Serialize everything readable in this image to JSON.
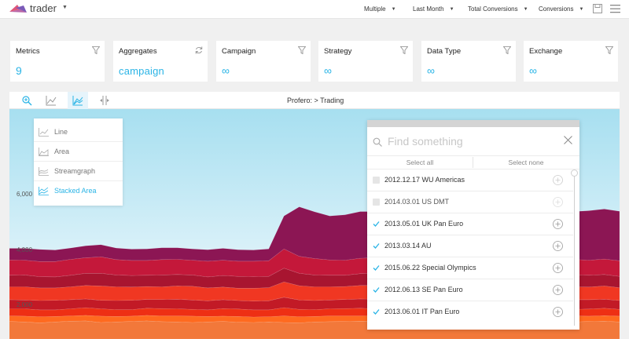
{
  "app": {
    "title": "trader"
  },
  "topbar": {
    "dropdowns": [
      {
        "label": "Multiple"
      },
      {
        "label": "Last Month"
      },
      {
        "label": "Total Conversions"
      },
      {
        "label": "Conversions"
      }
    ]
  },
  "cards": [
    {
      "title": "Metrics",
      "value": "9",
      "icon": "filter-icon"
    },
    {
      "title": "Aggregates",
      "value": "campaign",
      "icon": "refresh-icon"
    },
    {
      "title": "Campaign",
      "value": "∞",
      "icon": "filter-icon"
    },
    {
      "title": "Strategy",
      "value": "∞",
      "icon": "filter-icon"
    },
    {
      "title": "Data Type",
      "value": "∞",
      "icon": "filter-icon"
    },
    {
      "title": "Exchange",
      "value": "∞",
      "icon": "filter-icon"
    }
  ],
  "chart": {
    "breadcrumb": "Profero: > Trading",
    "chart_types": [
      {
        "label": "Line",
        "selected": false
      },
      {
        "label": "Area",
        "selected": false
      },
      {
        "label": "Streamgraph",
        "selected": false
      },
      {
        "label": "Stacked Area",
        "selected": true
      }
    ]
  },
  "finder": {
    "placeholder": "Find something",
    "select_all": "Select all",
    "select_none": "Select none",
    "items": [
      {
        "label": "2012.12.17 WU Americas",
        "checked": false
      },
      {
        "label": "2014.03.01 US DMT",
        "checked": false
      },
      {
        "label": "2013.05.01 UK Pan Euro",
        "checked": true
      },
      {
        "label": "2013.03.14 AU",
        "checked": true
      },
      {
        "label": "2015.06.22 Special Olympics",
        "checked": true
      },
      {
        "label": "2012.06.13 SE Pan Euro",
        "checked": true
      },
      {
        "label": "2013.06.01 IT Pan Euro",
        "checked": true
      }
    ]
  },
  "chart_data": {
    "type": "area",
    "stacked": true,
    "y_ticks": [
      "2,000",
      "4,000",
      "6,000"
    ],
    "ylim": [
      0,
      6600
    ],
    "x": [
      0,
      1,
      2,
      3,
      4,
      5,
      6,
      7,
      8,
      9,
      10,
      11,
      12,
      13,
      14,
      15,
      16,
      17,
      18,
      19,
      20,
      21,
      22,
      23,
      24,
      25,
      26,
      27,
      28,
      29,
      30,
      31,
      32,
      33,
      34,
      35,
      36,
      37,
      38,
      39,
      40
    ],
    "series": [
      {
        "color": "#f2783a",
        "values": [
          640,
          620,
          590,
          620,
          650,
          660,
          600,
          620,
          640,
          660,
          630,
          620,
          600,
          620,
          640,
          610,
          600,
          620,
          600,
          590,
          620,
          630,
          640,
          650,
          640,
          660,
          640,
          620,
          600,
          640,
          620,
          640,
          650,
          660,
          650,
          660,
          630,
          620,
          640,
          650,
          620
        ]
      },
      {
        "color": "#ff6a1f",
        "values": [
          200,
          210,
          220,
          200,
          190,
          200,
          230,
          200,
          190,
          200,
          210,
          220,
          230,
          200,
          190,
          210,
          200,
          190,
          240,
          220,
          200,
          210,
          200,
          190,
          210,
          200,
          190,
          210,
          220,
          200,
          190,
          200,
          210,
          200,
          190,
          210,
          200,
          220,
          190,
          200,
          210
        ]
      },
      {
        "color": "#ee2f14",
        "values": [
          260,
          270,
          250,
          240,
          260,
          280,
          270,
          250,
          240,
          260,
          270,
          260,
          250,
          240,
          280,
          270,
          260,
          250,
          300,
          270,
          250,
          260,
          270,
          280,
          250,
          260,
          270,
          250,
          240,
          260,
          270,
          280,
          250,
          260,
          270,
          260,
          250,
          240,
          260,
          270,
          250
        ]
      },
      {
        "color": "#c21a26",
        "values": [
          330,
          320,
          340,
          350,
          330,
          320,
          310,
          330,
          340,
          320,
          330,
          350,
          340,
          330,
          320,
          310,
          320,
          330,
          380,
          340,
          330,
          320,
          330,
          340,
          350,
          330,
          320,
          330,
          340,
          320,
          330,
          340,
          350,
          330,
          320,
          340,
          330,
          350,
          340,
          330,
          320
        ]
      },
      {
        "color": "#f03722",
        "values": [
          470,
          480,
          460,
          450,
          470,
          490,
          520,
          500,
          480,
          470,
          460,
          480,
          500,
          470,
          460,
          450,
          470,
          480,
          560,
          520,
          500,
          480,
          470,
          490,
          500,
          480,
          470,
          460,
          480,
          500,
          490,
          470,
          460,
          480,
          470,
          490,
          480,
          470,
          460,
          480,
          470
        ]
      },
      {
        "color": "#a81530",
        "values": [
          420,
          430,
          410,
          400,
          420,
          440,
          460,
          430,
          420,
          410,
          430,
          420,
          410,
          400,
          420,
          430,
          420,
          410,
          500,
          450,
          430,
          420,
          410,
          430,
          440,
          420,
          410,
          400,
          420,
          430,
          410,
          420,
          440,
          420,
          430,
          410,
          420,
          440,
          430,
          420,
          410
        ]
      },
      {
        "color": "#c4183a",
        "values": [
          560,
          540,
          550,
          560,
          580,
          570,
          600,
          560,
          550,
          540,
          560,
          550,
          540,
          570,
          560,
          550,
          560,
          570,
          700,
          620,
          600,
          560,
          550,
          560,
          570,
          560,
          550,
          560,
          570,
          560,
          550,
          560,
          570,
          560,
          550,
          560,
          570,
          560,
          550,
          560,
          570
        ]
      },
      {
        "color": "#8c1654",
        "values": [
          420,
          430,
          440,
          420,
          410,
          430,
          440,
          420,
          410,
          420,
          430,
          420,
          410,
          420,
          430,
          420,
          410,
          430,
          1200,
          1800,
          1700,
          1600,
          1650,
          1700,
          1680,
          1700,
          1720,
          1800,
          1780,
          1750,
          1760,
          1740,
          1800,
          1780,
          1720,
          1790,
          1760,
          1740,
          1800,
          1820,
          1800
        ]
      }
    ]
  }
}
